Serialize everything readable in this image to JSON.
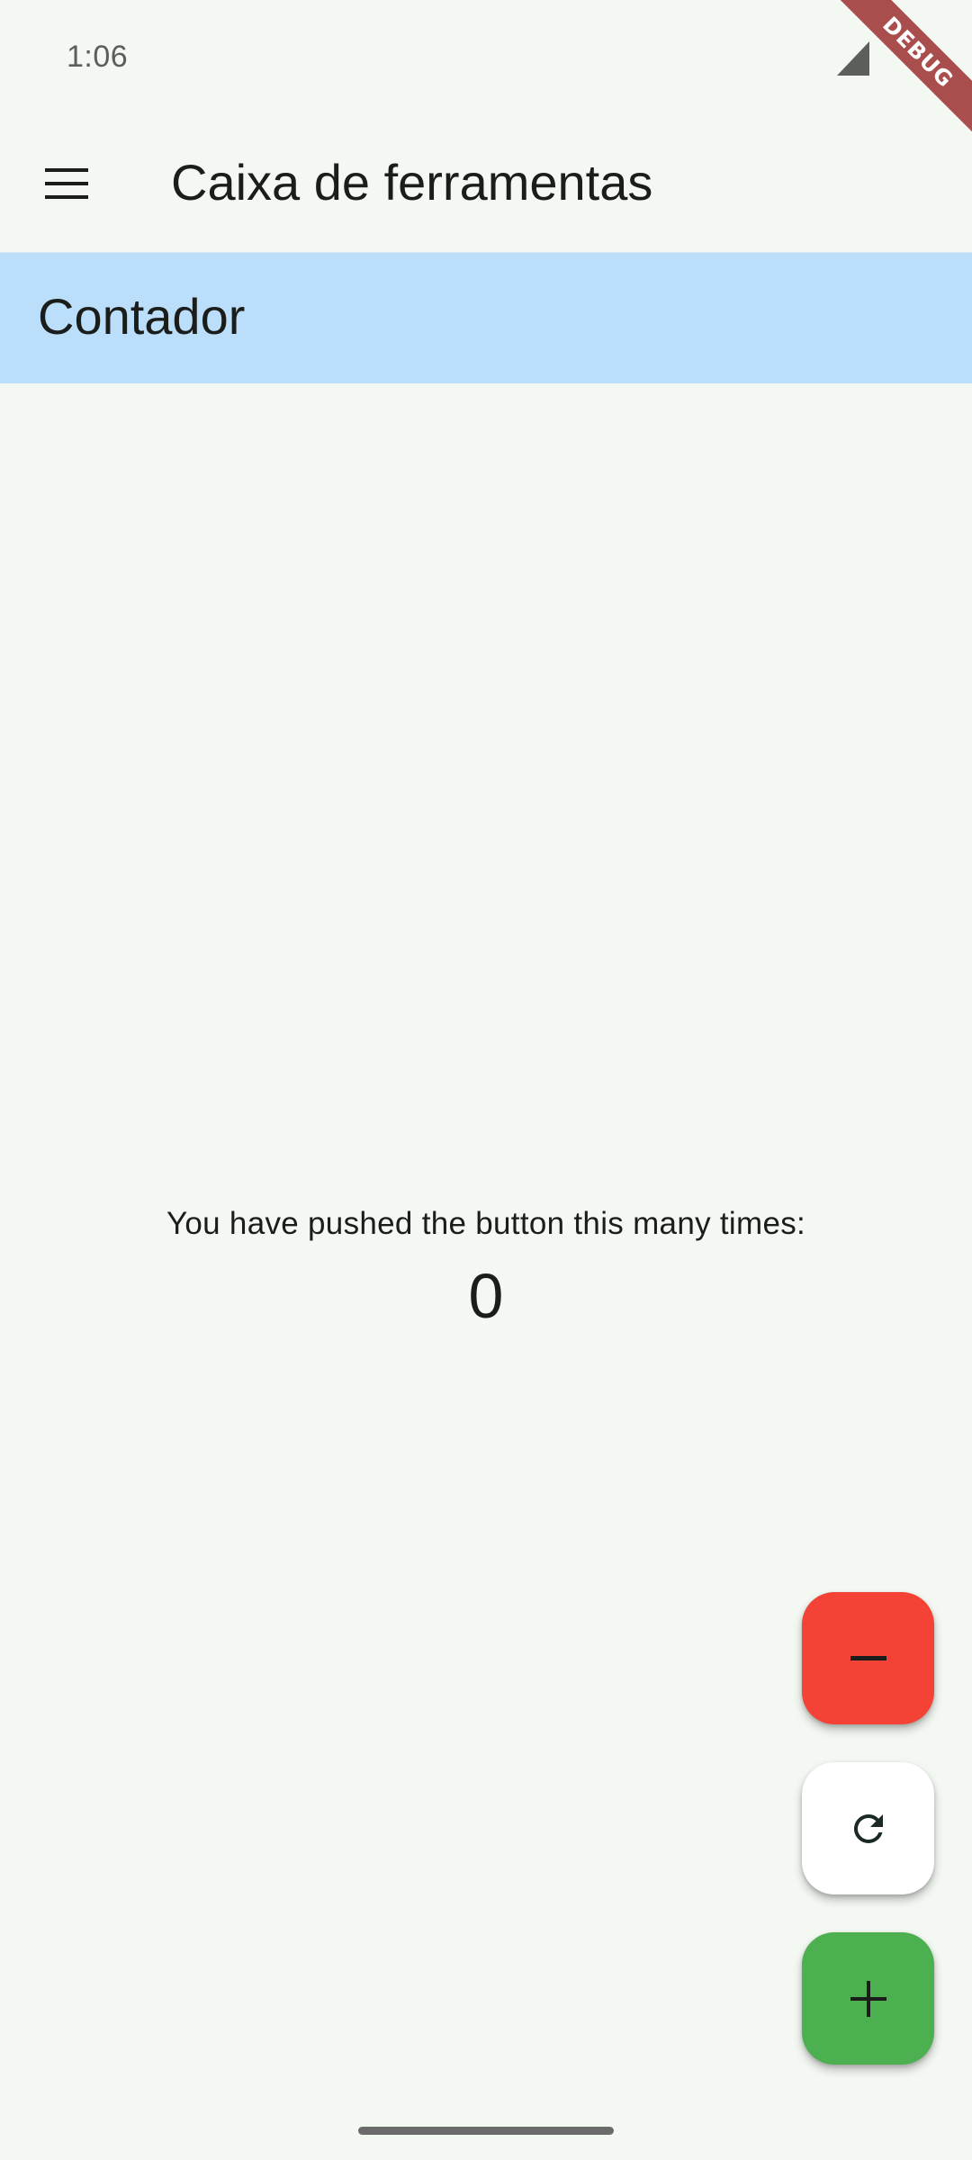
{
  "status_bar": {
    "time": "1:06",
    "icons": [
      "signal-icon"
    ]
  },
  "debug_banner": "DEBUG",
  "app_bar": {
    "title": "Caixa de ferramentas",
    "leading_icon": "menu-icon"
  },
  "section": {
    "title": "Contador",
    "background": "#bbdefb"
  },
  "counter": {
    "label": "You have pushed the button this many times:",
    "value": "0"
  },
  "fabs": [
    {
      "name": "decrement",
      "icon": "minus-icon",
      "color": "#f44336"
    },
    {
      "name": "reset",
      "icon": "refresh-icon",
      "color": "#ffffff"
    },
    {
      "name": "increment",
      "icon": "plus-icon",
      "color": "#4caf50"
    }
  ],
  "colors": {
    "background": "#f4f8f2",
    "text": "#1b1d1a"
  }
}
